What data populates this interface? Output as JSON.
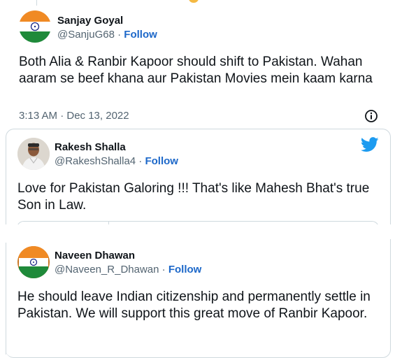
{
  "tweet1": {
    "name": "Sanjay Goyal",
    "handle": "@SanjuG68",
    "separator": " · ",
    "follow": "Follow",
    "text": "Both Alia & Ranbir Kapoor should shift to Pakistan. Wahan aaram se beef khana aur Pakistan Movies mein kaam karna",
    "timestamp": "3:13 AM · Dec 13, 2022",
    "info_icon": "info-circle-icon"
  },
  "tweet2": {
    "name": "Rakesh Shalla",
    "handle": "@RakeshShalla4",
    "separator": " · ",
    "follow": "Follow",
    "text": "Love for Pakistan Galoring !!! That's like Mahesh Bhat's true Son in Law.",
    "bird_icon": "twitter-bird-icon",
    "brand_color": "#1d9bf0"
  },
  "tweet3": {
    "name": "Naveen Dhawan",
    "handle": "@Naveen_R_Dhawan",
    "separator": " · ",
    "follow": "Follow",
    "text": "He should leave Indian citizenship and permanently settle in Pakistan. We will support this great move of Ranbir Kapoor."
  },
  "colors": {
    "follow": "#1d68c9",
    "secondary_text": "#536471",
    "border": "#cfd9de"
  }
}
